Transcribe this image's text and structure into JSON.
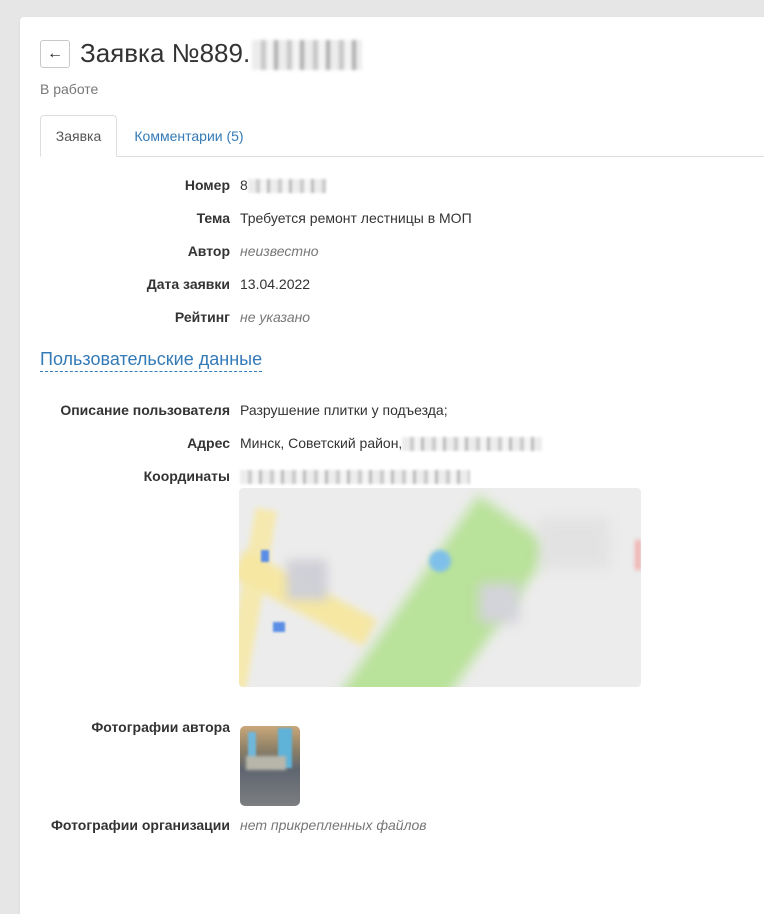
{
  "header": {
    "title_prefix": "Заявка №889.",
    "status": "В работе"
  },
  "tabs": [
    {
      "label": "Заявка",
      "active": true
    },
    {
      "label": "Комментарии (5)",
      "active": false
    }
  ],
  "details": {
    "number": {
      "label": "Номер",
      "value": "8"
    },
    "topic": {
      "label": "Тема",
      "value": "Требуется ремонт лестницы в МОП"
    },
    "author": {
      "label": "Автор",
      "value": "неизвестно"
    },
    "date": {
      "label": "Дата заявки",
      "value": "13.04.2022"
    },
    "rating": {
      "label": "Рейтинг",
      "value": "не указано"
    }
  },
  "user_section": {
    "title": "Пользовательские данные",
    "description": {
      "label": "Описание пользователя",
      "value": "Разрушение плитки у подъезда;"
    },
    "address": {
      "label": "Адрес",
      "value": "Минск, Советский район,"
    },
    "coordinates": {
      "label": "Координаты"
    },
    "author_photos": {
      "label": "Фотографии автора"
    },
    "org_photos": {
      "label": "Фотографии организации",
      "value": "нет прикрепленных файлов"
    }
  },
  "icons": {
    "back": "arrow-left-icon"
  },
  "colors": {
    "link": "#337ab7",
    "muted": "#777777",
    "background": "#e6e6e6"
  }
}
